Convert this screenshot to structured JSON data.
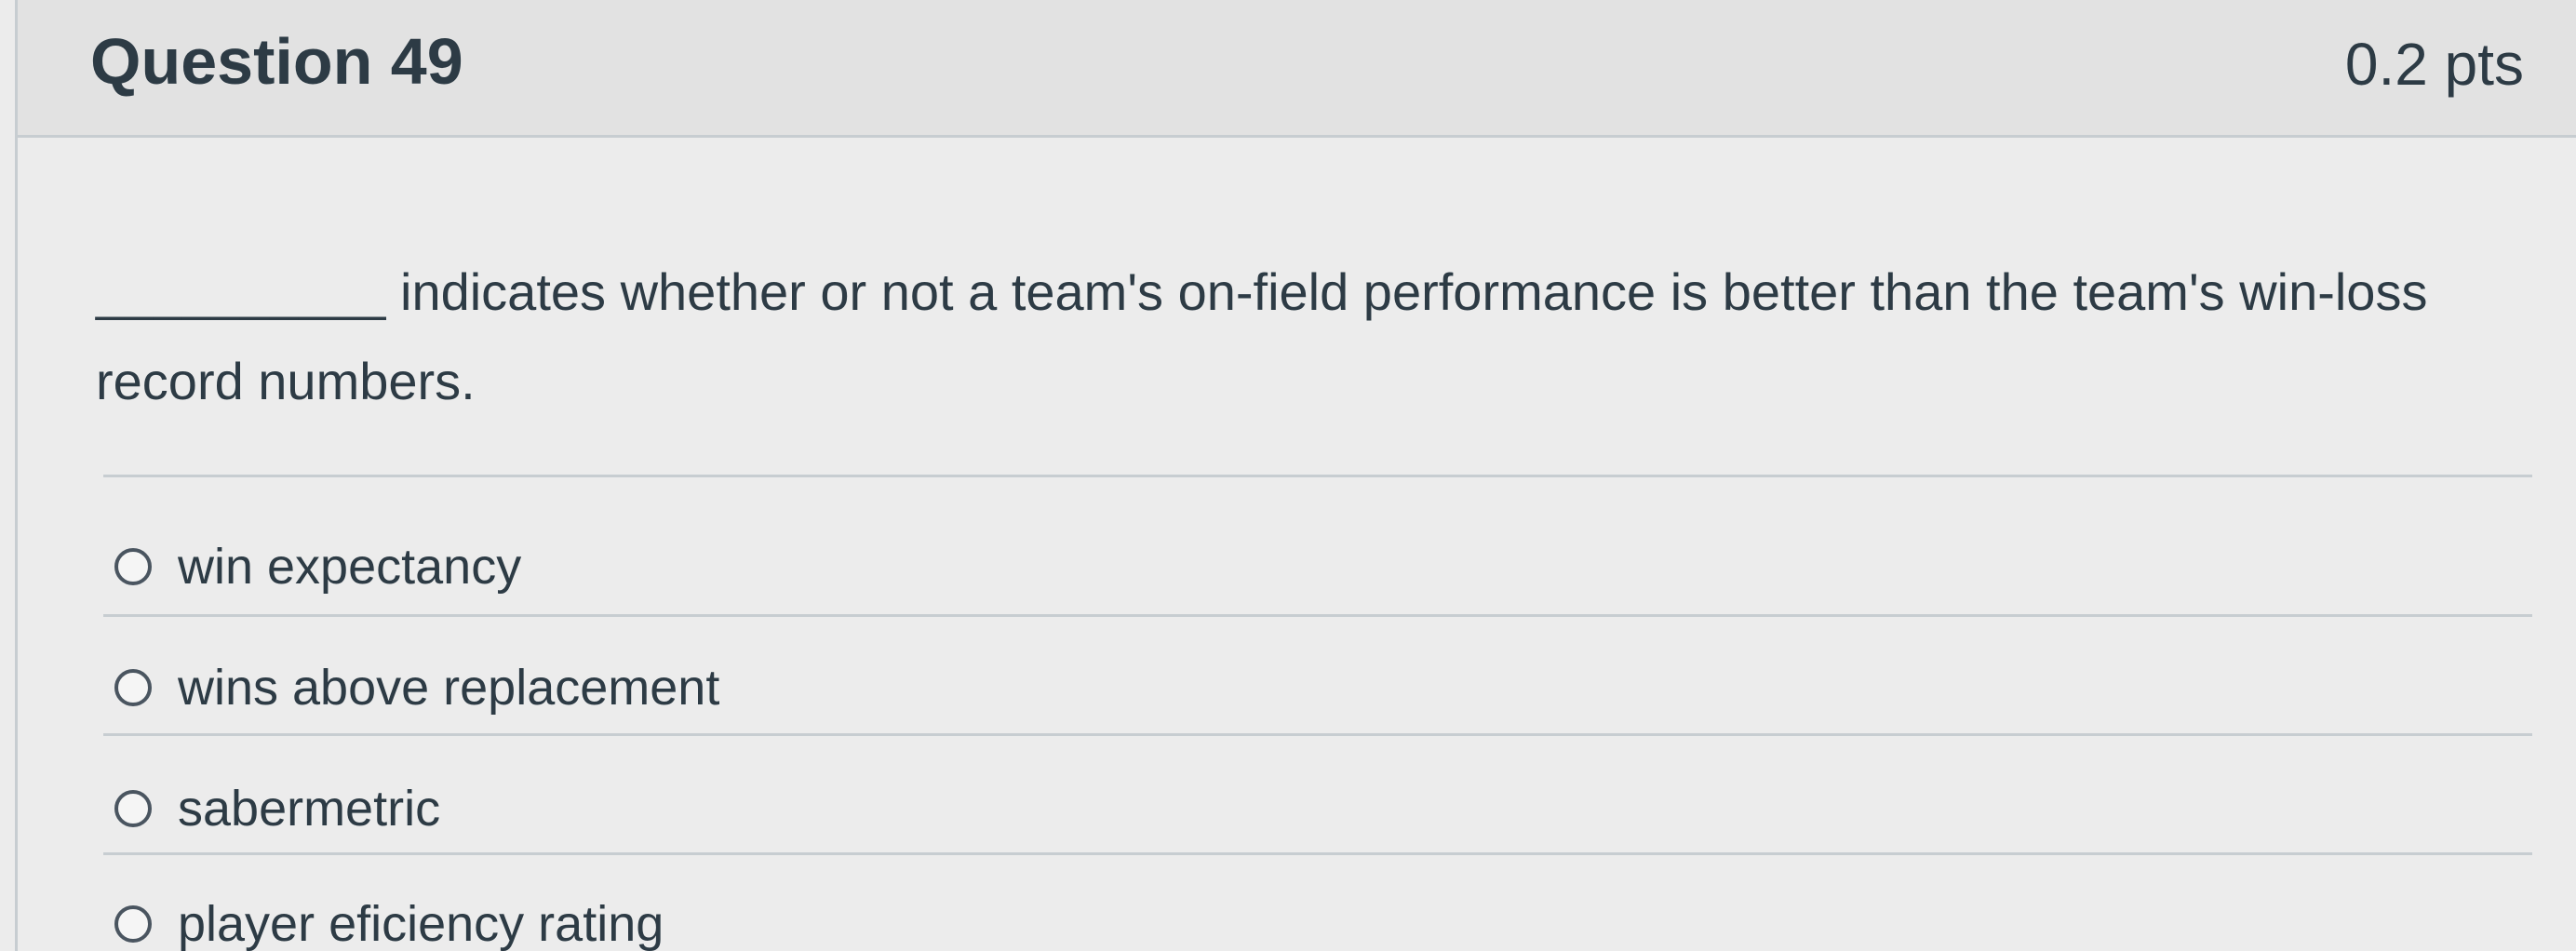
{
  "question": {
    "title": "Question 49",
    "points": "0.2 pts",
    "text": "__________ indicates whether or not a team's on-field performance is better than the team's win-loss record numbers."
  },
  "answers": [
    {
      "label": "win expectancy"
    },
    {
      "label": "wins above replacement"
    },
    {
      "label": "sabermetric"
    },
    {
      "label": "player eficiency rating"
    }
  ]
}
